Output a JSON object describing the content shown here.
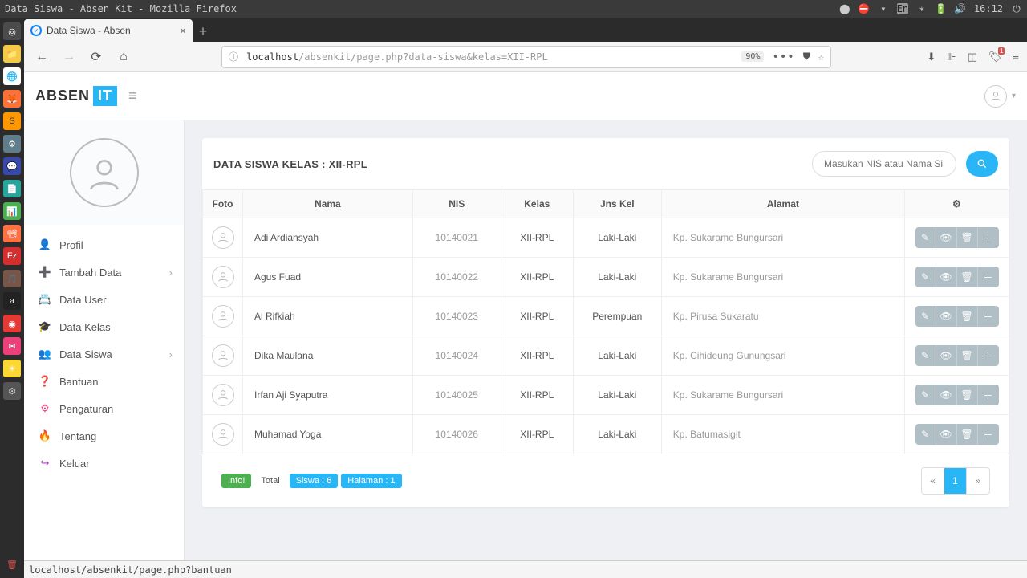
{
  "os": {
    "title": "Data Siswa - Absen Kit - Mozilla Firefox",
    "time": "16:12",
    "lang": "En",
    "status_url": "localhost/absenkit/page.php?bantuan"
  },
  "browser": {
    "tab_title": "Data Siswa - Absen",
    "url_host": "localhost",
    "url_path": "/absenkit/page.php?data-siswa&kelas=XII-RPL",
    "zoom": "90%"
  },
  "app": {
    "logo1": "ABSEN",
    "logo2": "IT"
  },
  "sidebar": {
    "items": [
      {
        "icon": "👤",
        "label": "Profil",
        "cls": "mi-profil"
      },
      {
        "icon": "➕",
        "label": "Tambah Data",
        "cls": "mi-tambah",
        "sub": true
      },
      {
        "icon": "📇",
        "label": "Data User",
        "cls": "mi-datauser"
      },
      {
        "icon": "🎓",
        "label": "Data Kelas",
        "cls": "mi-kelas"
      },
      {
        "icon": "👥",
        "label": "Data Siswa",
        "cls": "mi-siswa",
        "sub": true
      },
      {
        "icon": "❓",
        "label": "Bantuan",
        "cls": "mi-bantuan"
      },
      {
        "icon": "⚙",
        "label": "Pengaturan",
        "cls": "mi-pengaturan"
      },
      {
        "icon": "🔥",
        "label": "Tentang",
        "cls": "mi-tentang"
      },
      {
        "icon": "↪",
        "label": "Keluar",
        "cls": "mi-keluar"
      }
    ]
  },
  "table": {
    "title": "DATA SISWA KELAS : XII-RPL",
    "search_placeholder": "Masukan NIS atau Nama Si",
    "columns": [
      "Foto",
      "Nama",
      "NIS",
      "Kelas",
      "Jns Kel",
      "Alamat",
      "⚙"
    ],
    "rows": [
      {
        "nama": "Adi Ardiansyah",
        "nis": "10140021",
        "kelas": "XII-RPL",
        "jk": "Laki-Laki",
        "alamat": "Kp. Sukarame Bungursari"
      },
      {
        "nama": "Agus Fuad",
        "nis": "10140022",
        "kelas": "XII-RPL",
        "jk": "Laki-Laki",
        "alamat": "Kp. Sukarame Bungursari"
      },
      {
        "nama": "Ai Rifkiah",
        "nis": "10140023",
        "kelas": "XII-RPL",
        "jk": "Perempuan",
        "alamat": "Kp. Pirusa Sukaratu"
      },
      {
        "nama": "Dika Maulana",
        "nis": "10140024",
        "kelas": "XII-RPL",
        "jk": "Laki-Laki",
        "alamat": "Kp. Cihideung Gunungsari"
      },
      {
        "nama": "Irfan Aji Syaputra",
        "nis": "10140025",
        "kelas": "XII-RPL",
        "jk": "Laki-Laki",
        "alamat": "Kp. Sukarame Bungursari"
      },
      {
        "nama": "Muhamad Yoga",
        "nis": "10140026",
        "kelas": "XII-RPL",
        "jk": "Laki-Laki",
        "alamat": "Kp. Batumasigit"
      }
    ]
  },
  "footer": {
    "info": "Info!",
    "total": "Total",
    "siswa": "Siswa : 6",
    "halaman": "Halaman : 1",
    "page": "1"
  }
}
